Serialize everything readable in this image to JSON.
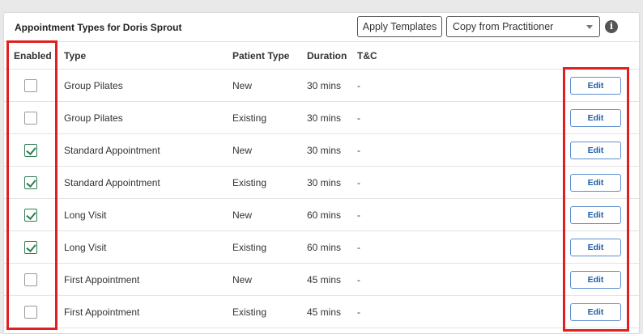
{
  "header": {
    "title": "Appointment Types for Doris Sprout",
    "apply_templates_label": "Apply Templates",
    "copy_select_value": "Copy from Practitioner",
    "info_glyph": "i"
  },
  "columns": {
    "enabled": "Enabled",
    "type": "Type",
    "patient_type": "Patient Type",
    "duration": "Duration",
    "tc": "T&C"
  },
  "rows": [
    {
      "enabled": false,
      "type": "Group Pilates",
      "patient_type": "New",
      "duration": "30 mins",
      "tc": "-",
      "edit_label": "Edit"
    },
    {
      "enabled": false,
      "type": "Group Pilates",
      "patient_type": "Existing",
      "duration": "30 mins",
      "tc": "-",
      "edit_label": "Edit"
    },
    {
      "enabled": true,
      "type": "Standard Appointment",
      "patient_type": "New",
      "duration": "30 mins",
      "tc": "-",
      "edit_label": "Edit"
    },
    {
      "enabled": true,
      "type": "Standard Appointment",
      "patient_type": "Existing",
      "duration": "30 mins",
      "tc": "-",
      "edit_label": "Edit"
    },
    {
      "enabled": true,
      "type": "Long Visit",
      "patient_type": "New",
      "duration": "60 mins",
      "tc": "-",
      "edit_label": "Edit"
    },
    {
      "enabled": true,
      "type": "Long Visit",
      "patient_type": "Existing",
      "duration": "60 mins",
      "tc": "-",
      "edit_label": "Edit"
    },
    {
      "enabled": false,
      "type": "First Appointment",
      "patient_type": "New",
      "duration": "45 mins",
      "tc": "-",
      "edit_label": "Edit"
    },
    {
      "enabled": false,
      "type": "First Appointment",
      "patient_type": "Existing",
      "duration": "45 mins",
      "tc": "-",
      "edit_label": "Edit"
    }
  ],
  "colors": {
    "highlight": "#e02020",
    "check": "#2e7d52",
    "edit_text": "#1d5fa8",
    "edit_border": "#5b8fd0"
  }
}
